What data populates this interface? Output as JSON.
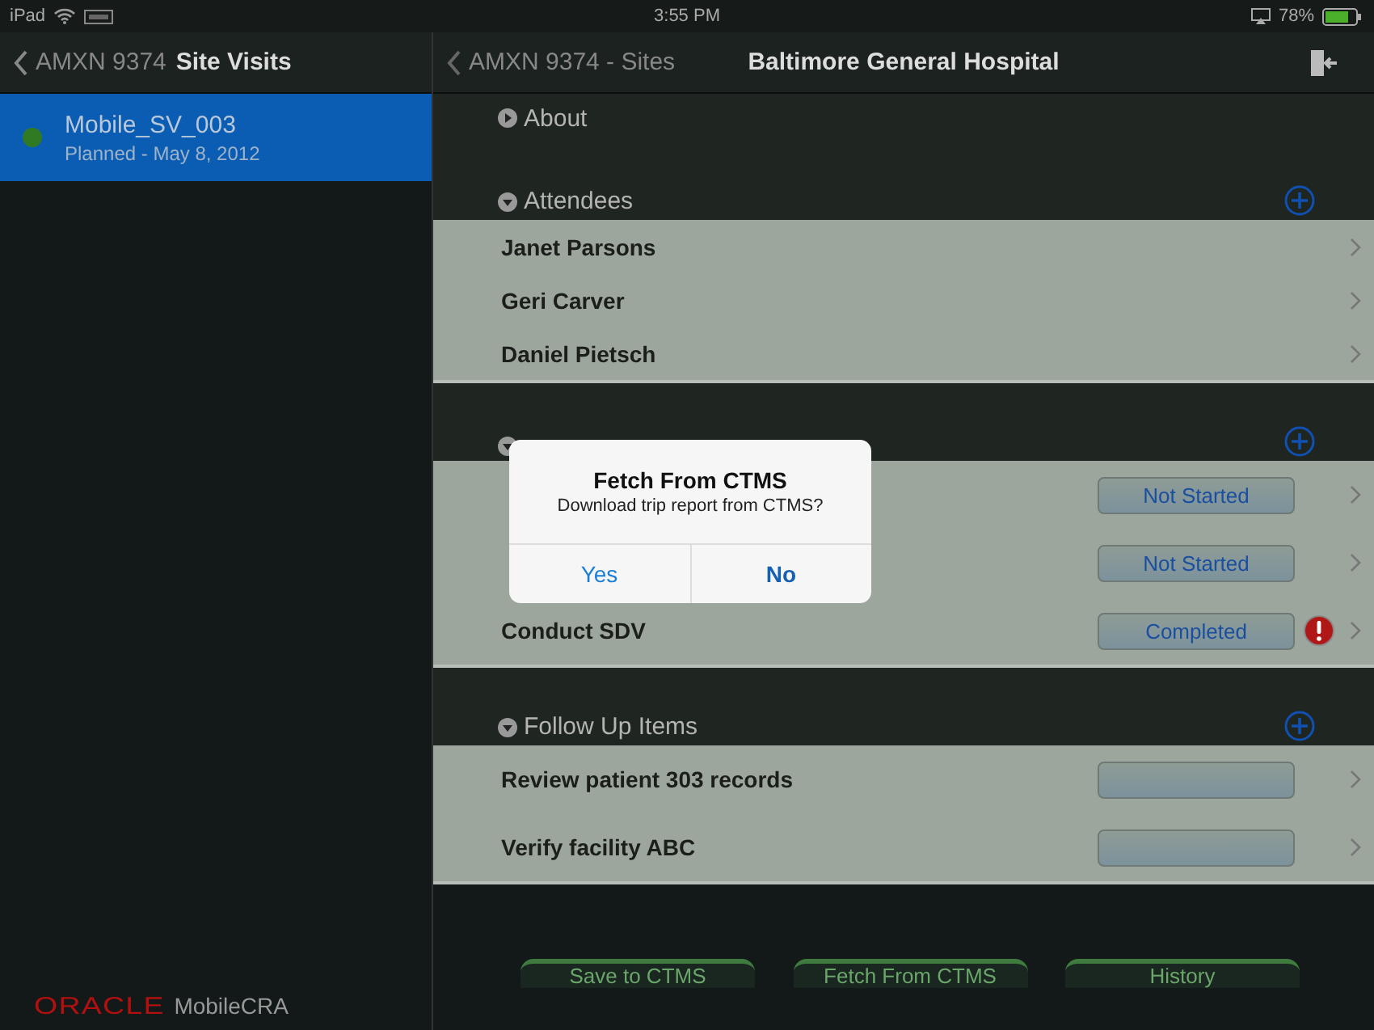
{
  "status_bar": {
    "carrier": "iPad",
    "time": "3:55 PM",
    "battery": "78%"
  },
  "master": {
    "back": "AMXN 9374",
    "title": "Site Visits",
    "items": [
      {
        "title": "Mobile_SV_003",
        "subtitle": "Planned - May 8, 2012",
        "selected": true,
        "color": "#2f7a22"
      }
    ],
    "logo": {
      "brand": "ORACLE",
      "product": "MobileCRA"
    }
  },
  "detail": {
    "back": "AMXN 9374 - Sites",
    "title": "Baltimore General Hospital",
    "sections": [
      {
        "title": "About",
        "expanded": false,
        "addable": false
      },
      {
        "title": "Attendees",
        "expanded": true,
        "addable": true,
        "rows": [
          {
            "title": "Janet Parsons"
          },
          {
            "title": "Geri Carver"
          },
          {
            "title": "Daniel Pietsch"
          }
        ]
      },
      {
        "expanded": true,
        "addable": true,
        "rows": [
          {
            "status": "Not Started",
            "warning": false
          },
          {
            "status": "Not Started",
            "warning": false
          },
          {
            "title": "Conduct SDV",
            "status": "Completed",
            "warning": true
          }
        ]
      },
      {
        "title": "Follow Up Items",
        "expanded": true,
        "addable": true,
        "rows": [
          {
            "title": "Review patient 303 records",
            "status": "",
            "warning": false
          },
          {
            "title": "Verify facility ABC",
            "status": "",
            "warning": false
          }
        ]
      }
    ],
    "actions": [
      "Save to CTMS",
      "Fetch From CTMS",
      "History"
    ]
  },
  "dialog": {
    "title": "Fetch From CTMS",
    "message": "Download trip report from CTMS?",
    "buttons": [
      {
        "label": "Yes",
        "preferred": false
      },
      {
        "label": "No",
        "preferred": true
      }
    ]
  }
}
